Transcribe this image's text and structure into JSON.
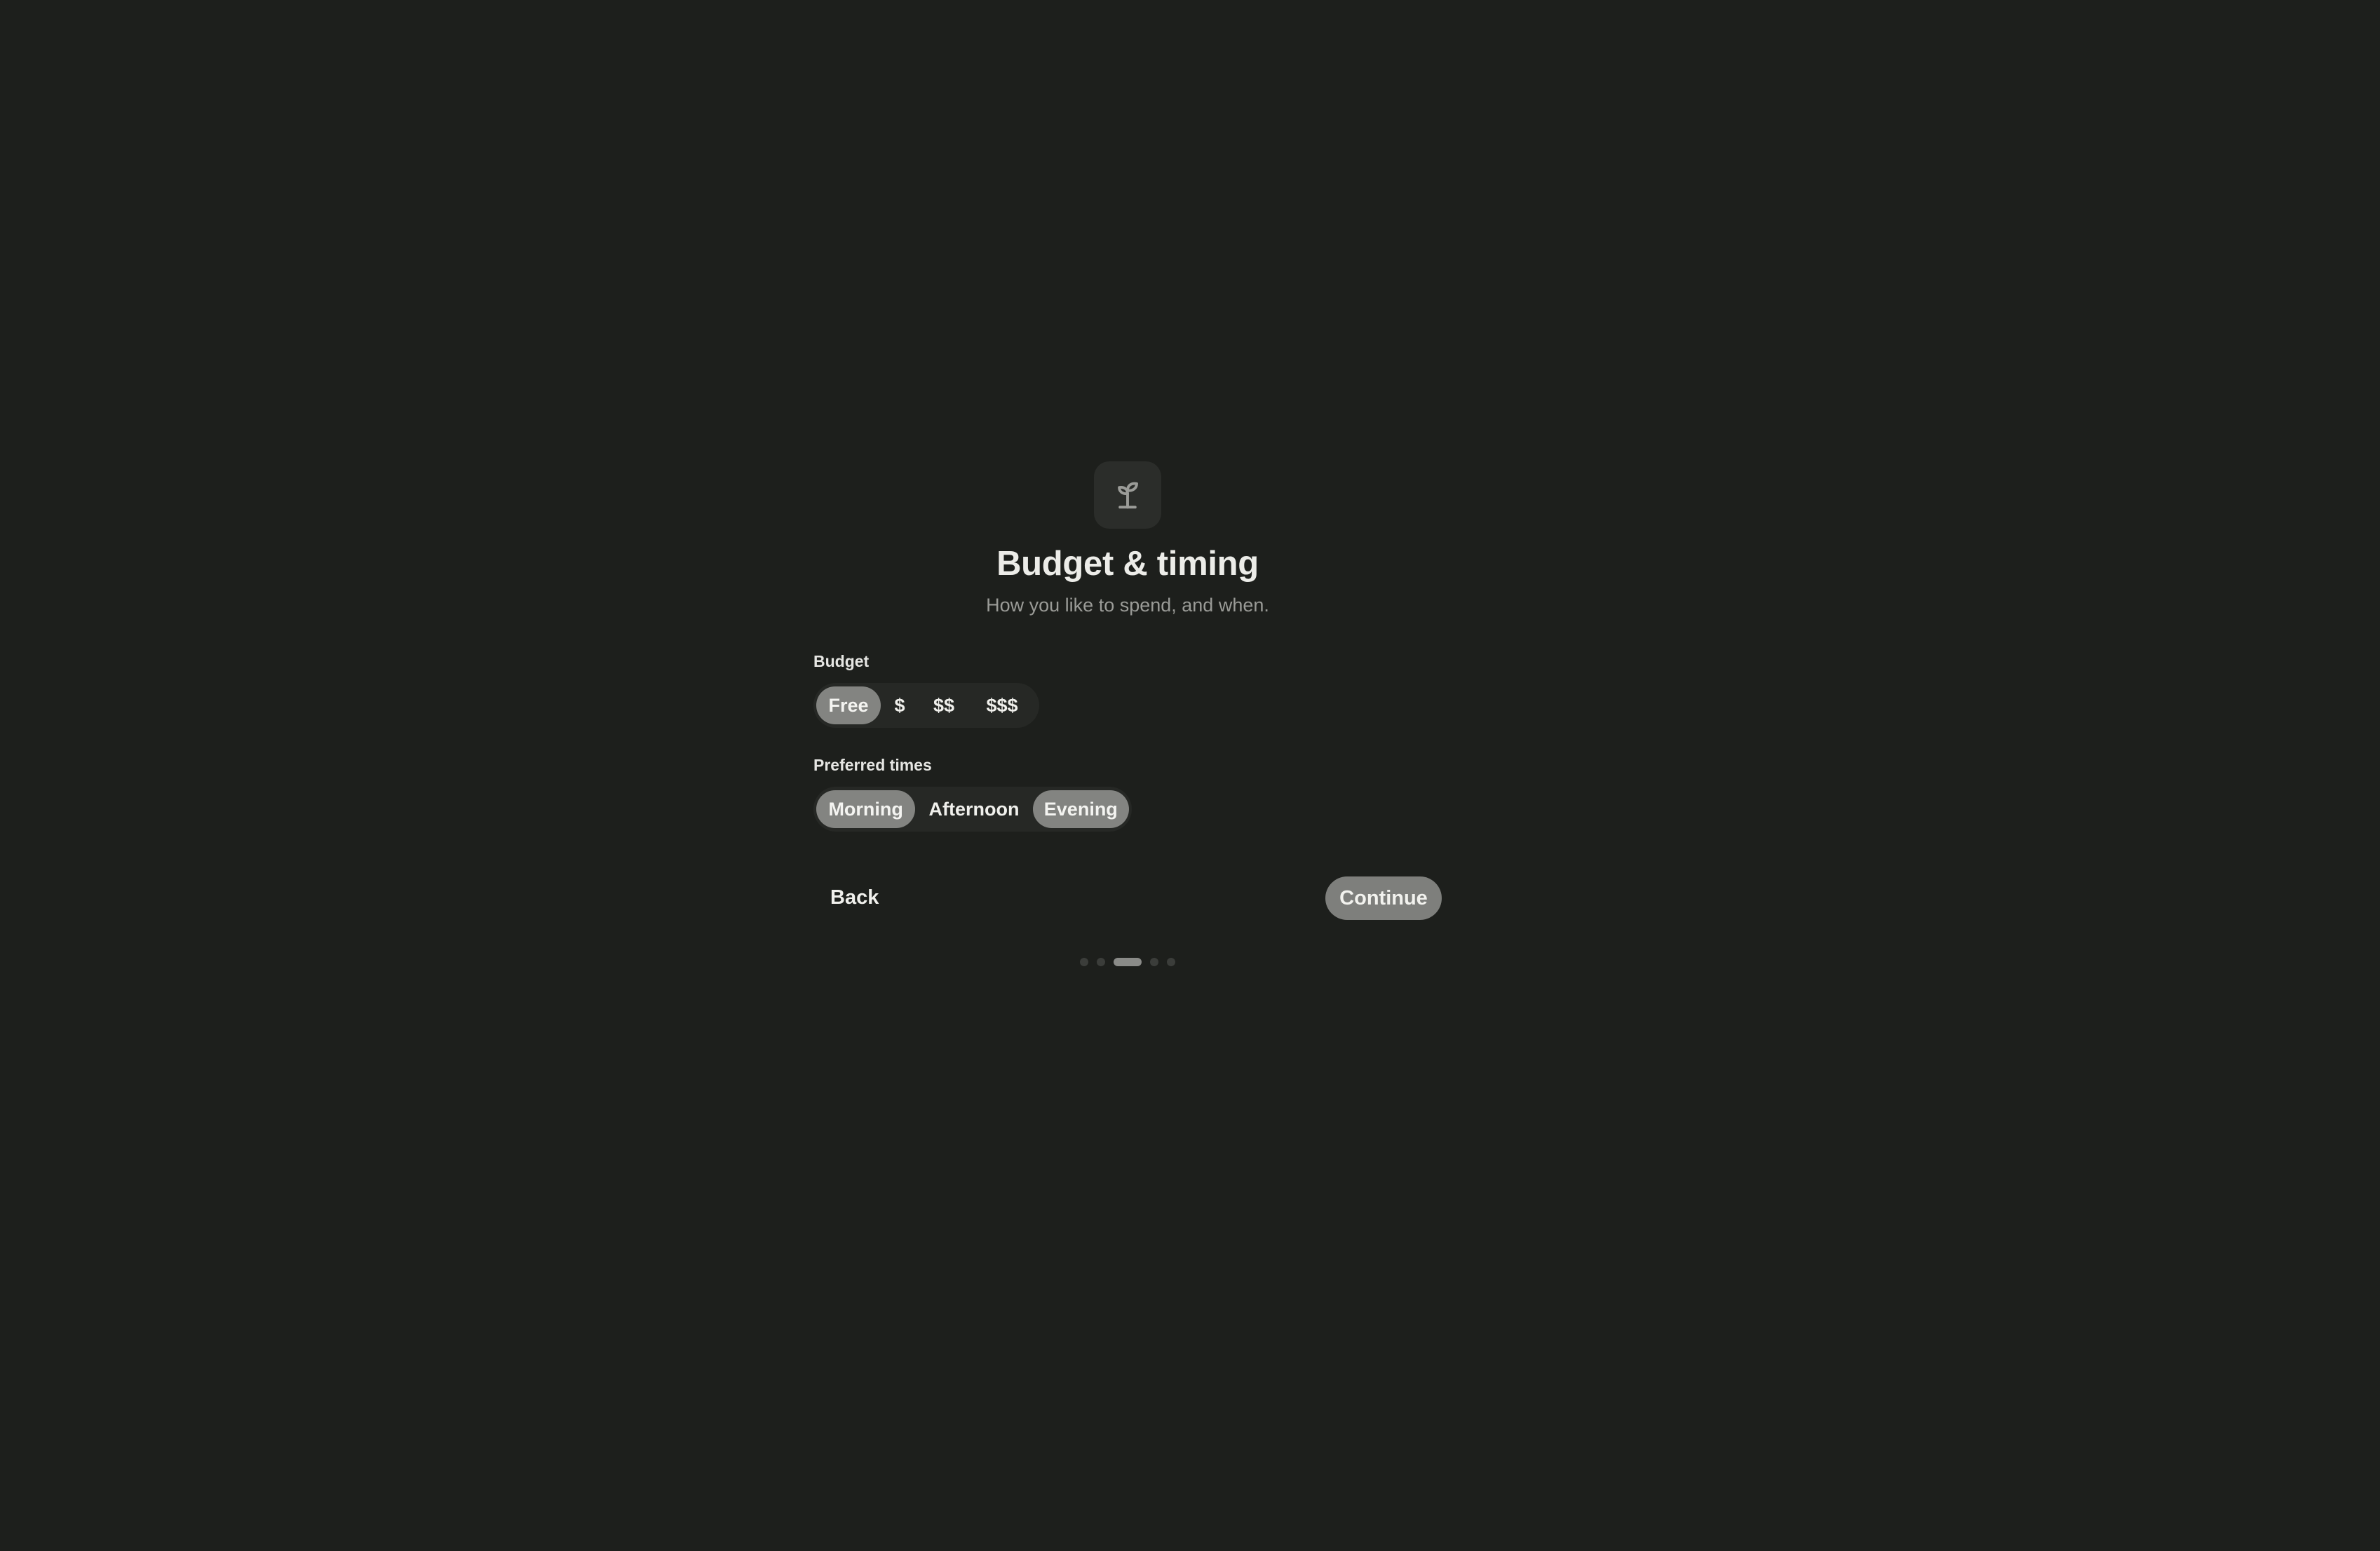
{
  "header": {
    "icon": "sprout-icon",
    "title": "Budget & timing",
    "subtitle": "How you like to spend, and when."
  },
  "budget": {
    "label": "Budget",
    "options": [
      "Free",
      "$",
      "$$",
      "$$$"
    ],
    "selected": [
      "Free"
    ]
  },
  "times": {
    "label": "Preferred times",
    "options": [
      "Morning",
      "Afternoon",
      "Evening"
    ],
    "selected": [
      "Morning",
      "Evening"
    ]
  },
  "nav": {
    "back_label": "Back",
    "continue_label": "Continue"
  },
  "progress": {
    "total_steps": 5,
    "current_step": 3
  },
  "colors": {
    "background": "#1d1f1c",
    "selected_pill": "#838481",
    "track": "#262825"
  }
}
